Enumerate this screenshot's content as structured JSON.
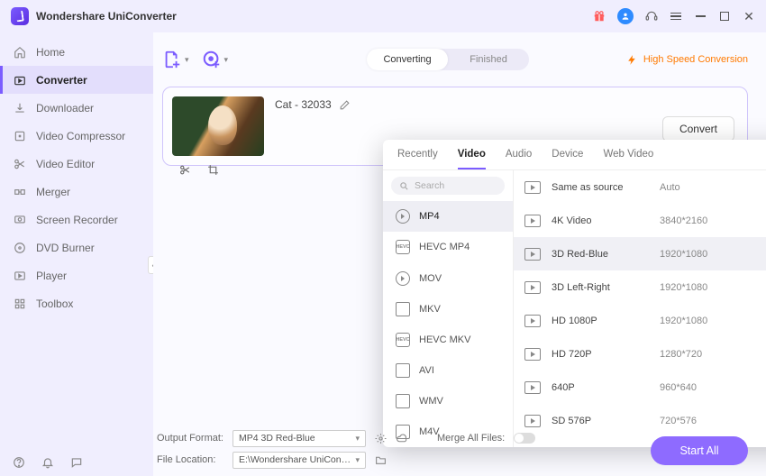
{
  "app": {
    "name": "Wondershare UniConverter"
  },
  "sidebar": {
    "items": [
      {
        "label": "Home"
      },
      {
        "label": "Converter"
      },
      {
        "label": "Downloader"
      },
      {
        "label": "Video Compressor"
      },
      {
        "label": "Video Editor"
      },
      {
        "label": "Merger"
      },
      {
        "label": "Screen Recorder"
      },
      {
        "label": "DVD Burner"
      },
      {
        "label": "Player"
      },
      {
        "label": "Toolbox"
      }
    ]
  },
  "toolbar": {
    "tabs": {
      "converting": "Converting",
      "finished": "Finished"
    },
    "high_speed": "High Speed Conversion"
  },
  "file": {
    "name": "Cat - 32033",
    "convert_label": "Convert"
  },
  "fmt_popup": {
    "tabs": [
      "Recently",
      "Video",
      "Audio",
      "Device",
      "Web Video"
    ],
    "active_tab": 1,
    "search_placeholder": "Search",
    "left": [
      "MP4",
      "HEVC MP4",
      "MOV",
      "MKV",
      "HEVC MKV",
      "AVI",
      "WMV",
      "M4V"
    ],
    "left_selected": 0,
    "right": [
      {
        "name": "Same as source",
        "res": "Auto"
      },
      {
        "name": "4K Video",
        "res": "3840*2160"
      },
      {
        "name": "3D Red-Blue",
        "res": "1920*1080",
        "hover": true
      },
      {
        "name": "3D Left-Right",
        "res": "1920*1080"
      },
      {
        "name": "HD 1080P",
        "res": "1920*1080"
      },
      {
        "name": "HD 720P",
        "res": "1280*720"
      },
      {
        "name": "640P",
        "res": "960*640"
      },
      {
        "name": "SD 576P",
        "res": "720*576"
      }
    ]
  },
  "bottom": {
    "output_format_label": "Output Format:",
    "output_format_value": "MP4 3D Red-Blue",
    "file_location_label": "File Location:",
    "file_location_value": "E:\\Wondershare UniConverter",
    "merge_label": "Merge All Files:",
    "start_all": "Start All"
  }
}
